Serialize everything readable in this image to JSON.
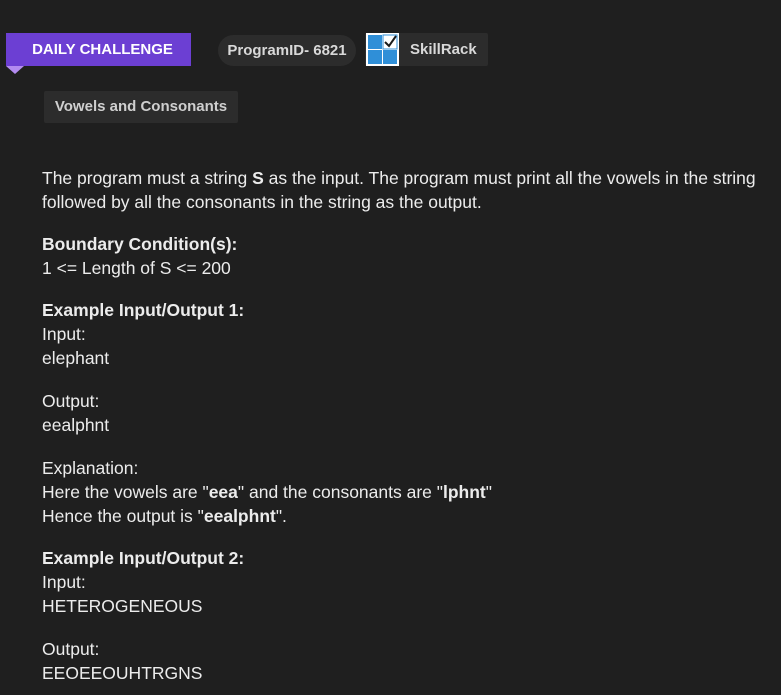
{
  "header": {
    "ribbon_label": "DAILY CHALLENGE",
    "program_id": "ProgramID- 6821",
    "brand_label": "SkillRack",
    "problem_title": "Vowels and Consonants"
  },
  "colors": {
    "ribbon": "#6c3fd3",
    "ribbon_fold": "#b38bf0",
    "background": "#1f1f1f",
    "chip": "#2c2c2c",
    "logo_blue": "#2f8fd8"
  },
  "problem": {
    "intro_part1": "The program must a string ",
    "intro_var": "S",
    "intro_part2": " as the input. The program must print all the vowels in the string followed by all the consonants in the string as the output.",
    "boundary_heading": "Boundary Condition(s):",
    "boundary_value": "1 <= Length of S <= 200",
    "example1": {
      "heading": "Example Input/Output 1:",
      "input_label": "Input:",
      "input_value": "elephant",
      "output_label": "Output:",
      "output_value": "eealphnt",
      "explanation_label": "Explanation:",
      "exp_line1_part1": "Here the vowels are \"",
      "exp_vowels": "eea",
      "exp_line1_part2": "\" and the consonants are \"",
      "exp_consonants": "lphnt",
      "exp_line1_part3": "\"",
      "exp_line2_part1": "Hence the output is \"",
      "exp_result": "eealphnt",
      "exp_line2_part2": "\"."
    },
    "example2": {
      "heading": "Example Input/Output 2:",
      "input_label": "Input:",
      "input_value": "HETEROGENEOUS",
      "output_label": "Output:",
      "output_value": "EEOEEOUHTRGNS"
    }
  }
}
